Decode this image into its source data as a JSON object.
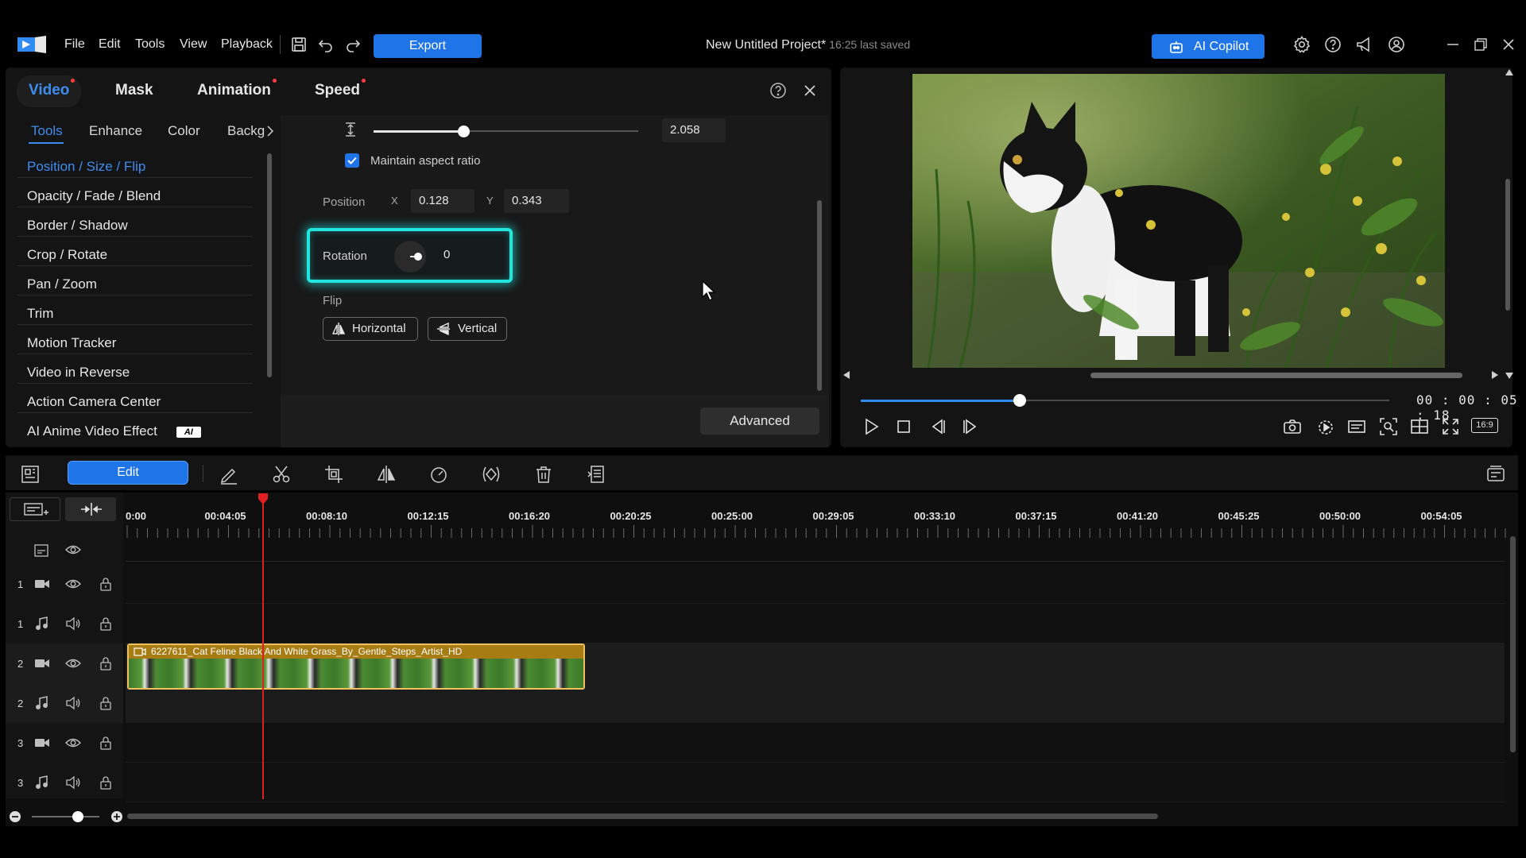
{
  "menu": {
    "items": [
      "File",
      "Edit",
      "Tools",
      "View",
      "Playback"
    ],
    "export_label": "Export"
  },
  "project": {
    "title": "New Untitled Project*",
    "saved": "16:25 last saved"
  },
  "copilot": {
    "label": "AI Copilot"
  },
  "props": {
    "tabs": [
      "Video",
      "Mask",
      "Animation",
      "Speed"
    ],
    "subtabs": [
      "Tools",
      "Enhance",
      "Color",
      "Backg"
    ],
    "tools": [
      "Position / Size / Flip",
      "Opacity / Fade / Blend",
      "Border / Shadow",
      "Crop / Rotate",
      "Pan / Zoom",
      "Trim",
      "Motion Tracker",
      "Video in Reverse",
      "Action Camera Center",
      "AI Anime Video Effect"
    ],
    "ai_badge": "AI",
    "scale_value": "2.058",
    "scale_slider_fraction": 0.34,
    "maintain_aspect": "Maintain aspect ratio",
    "position_label": "Position",
    "x_label": "X",
    "x_value": "0.128",
    "y_label": "Y",
    "y_value": "0.343",
    "rotation_label": "Rotation",
    "rotation_value": "0",
    "flip_label": "Flip",
    "flip_horizontal": "Horizontal",
    "flip_vertical": "Vertical",
    "advanced_label": "Advanced"
  },
  "preview": {
    "timecode": "00 : 00 : 05 : 18",
    "progress_fraction": 0.3,
    "aspect": "16:9"
  },
  "timeline": {
    "edit_label": "Edit",
    "ticks": [
      "0:00",
      "00:04:05",
      "00:08:10",
      "00:12:15",
      "00:16:20",
      "00:20:25",
      "00:25:00",
      "00:29:05",
      "00:33:10",
      "00:37:15",
      "00:41:20",
      "00:45:25",
      "00:50:00",
      "00:54:05"
    ],
    "tracks": [
      "1",
      "1",
      "2",
      "2",
      "3",
      "3"
    ],
    "clip_title": "6227611_Cat Feline Black And White Grass_By_Gentle_Steps_Artist_HD"
  },
  "colors": {
    "accent": "#1f74e8",
    "highlight": "#21e6e0",
    "playhead": "#e02020",
    "clip_header": "#a77c12"
  }
}
